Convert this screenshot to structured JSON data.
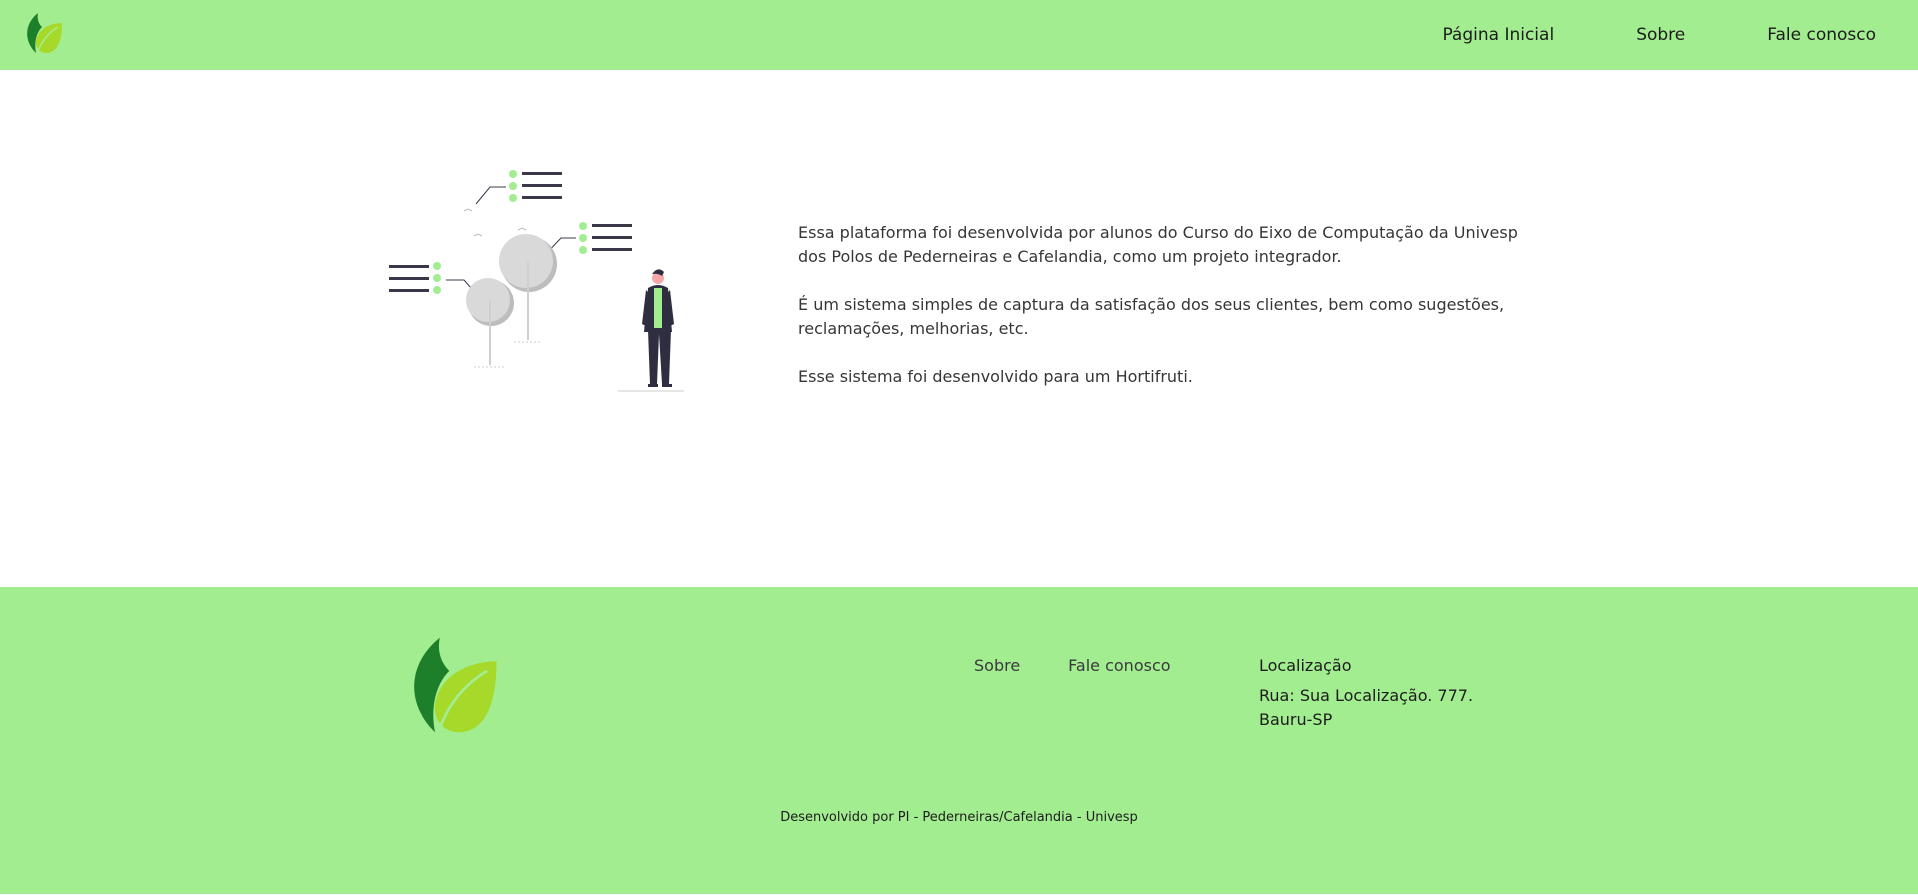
{
  "header": {
    "logo_icon": "leaf-logo-icon",
    "nav": [
      {
        "label": "Página Inicial"
      },
      {
        "label": "Sobre"
      },
      {
        "label": "Fale conosco"
      }
    ]
  },
  "main": {
    "illustration_icon": "person-with-trees-and-lists-illustration",
    "paragraphs": [
      "Essa plataforma foi desenvolvida por alunos do Curso do Eixo de Computação da Univesp dos Polos de Pederneiras e Cafelandia, como um projeto integrador.",
      "É um sistema simples de captura da satisfação dos seus clientes, bem como sugestões, reclamações, melhorias, etc.",
      "Esse sistema foi desenvolvido para um Hortifruti."
    ]
  },
  "footer": {
    "logo_icon": "leaf-logo-icon",
    "links": [
      {
        "label": "Sobre"
      },
      {
        "label": "Fale conosco"
      }
    ],
    "location_title": "Localização",
    "address_line1": "Rua: Sua Localização. 777.",
    "address_line2": "Bauru-SP",
    "credits": "Desenvolvido por PI - Pederneiras/Cafelandia - Univesp"
  },
  "colors": {
    "bar_green": "#a3ed91",
    "leaf_dark": "#1e7f2a",
    "leaf_light": "#a6d92a"
  }
}
